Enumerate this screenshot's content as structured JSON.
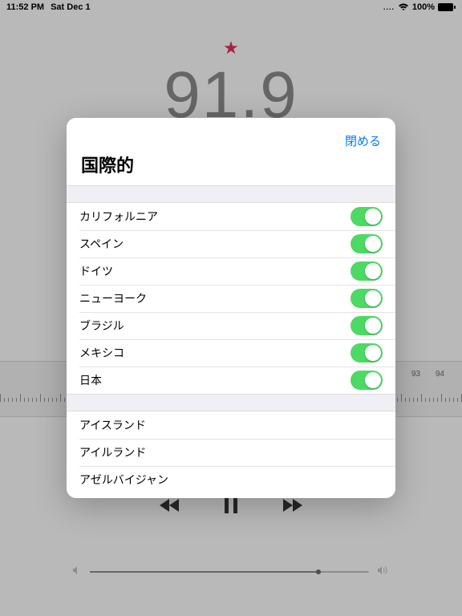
{
  "statusbar": {
    "time": "11:52 PM",
    "date": "Sat Dec 1",
    "battery_pct": "100%"
  },
  "radio": {
    "frequency": "91.9",
    "ruler_labels": [
      "93",
      "94"
    ]
  },
  "modal": {
    "close_label": "閉める",
    "title": "国際的",
    "section1": [
      {
        "label": "カリフォルニア",
        "on": true
      },
      {
        "label": "スペイン",
        "on": true
      },
      {
        "label": "ドイツ",
        "on": true
      },
      {
        "label": "ニューヨーク",
        "on": true
      },
      {
        "label": "ブラジル",
        "on": true
      },
      {
        "label": "メキシコ",
        "on": true
      },
      {
        "label": "日本",
        "on": true
      }
    ],
    "section2": [
      {
        "label": "アイスランド"
      },
      {
        "label": "アイルランド"
      },
      {
        "label": "アゼルバイジャン"
      }
    ]
  }
}
